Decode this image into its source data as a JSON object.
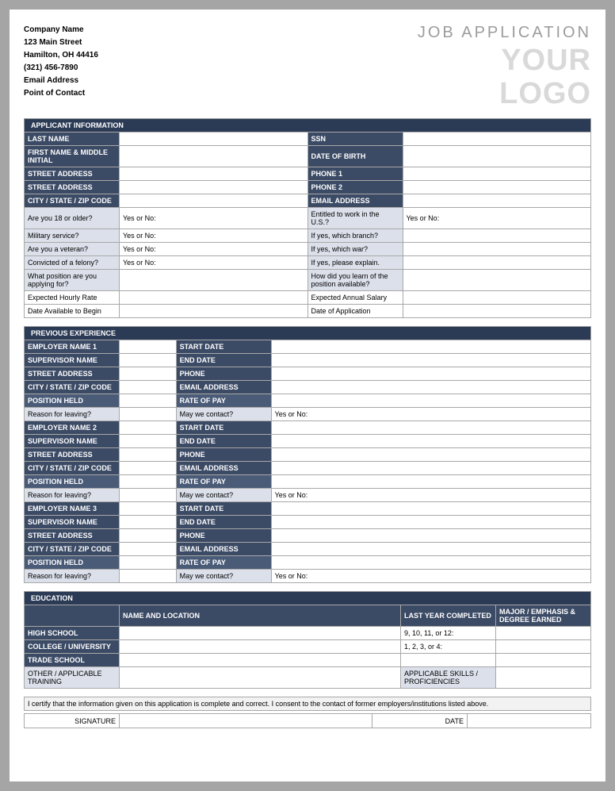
{
  "company": {
    "name": "Company Name",
    "street": "123 Main Street",
    "citystate": "Hamilton, OH 44416",
    "phone": "(321) 456-7890",
    "email": "Email Address",
    "contact": "Point of Contact"
  },
  "header": {
    "title": "JOB APPLICATION",
    "logo1": "YOUR",
    "logo2": "LOGO"
  },
  "sec": {
    "applicant": "APPLICANT INFORMATION",
    "previous": "PREVIOUS EXPERIENCE",
    "education": "EDUCATION"
  },
  "app": {
    "last_name": "LAST NAME",
    "ssn": "SSN",
    "first_mi": "FIRST NAME & MIDDLE INITIAL",
    "dob": "DATE OF BIRTH",
    "street1": "STREET ADDRESS",
    "phone1": "PHONE 1",
    "street2": "STREET ADDRESS",
    "phone2": "PHONE 2",
    "csz": "CITY / STATE / ZIP CODE",
    "email": "EMAIL ADDRESS",
    "age18": "Are you 18 or older?",
    "yesno": "Yes or No:",
    "entitled": "Entitled to work in the U.S.?",
    "military": "Military service?",
    "branch": "If yes, which branch?",
    "veteran": "Are you a veteran?",
    "war": "If yes, which war?",
    "felony": "Convicted of a felony?",
    "explain": "If yes, please explain.",
    "position": "What position are you applying for?",
    "learn": "How did you learn of the position available?",
    "hourly": "Expected Hourly Rate",
    "salary": "Expected Annual Salary",
    "date_begin": "Date Available to Begin",
    "date_app": "Date of Application"
  },
  "exp": {
    "emp1": "EMPLOYER NAME 1",
    "emp2": "EMPLOYER NAME 2",
    "emp3": "EMPLOYER NAME 3",
    "start": "START DATE",
    "end": "END DATE",
    "sup": "SUPERVISOR NAME",
    "street": "STREET ADDRESS",
    "phone": "PHONE",
    "csz": "CITY / STATE / ZIP CODE",
    "email": "EMAIL ADDRESS",
    "pos": "POSITION HELD",
    "rate": "RATE OF PAY",
    "reason": "Reason for leaving?",
    "contact": "May we contact?",
    "yesno": "Yes or No:"
  },
  "edu": {
    "name_loc": "NAME AND LOCATION",
    "last_year": "LAST YEAR COMPLETED",
    "major": "MAJOR / EMPHASIS & DEGREE EARNED",
    "hs": "HIGH SCHOOL",
    "hs_hint": "9, 10, 11, or 12:",
    "college": "COLLEGE / UNIVERSITY",
    "college_hint": "1, 2, 3, or 4:",
    "trade": "TRADE SCHOOL",
    "other": "OTHER / APPLICABLE TRAINING",
    "skills": "APPLICABLE SKILLS / PROFICIENCIES"
  },
  "certify": "I certify that the information given on this application is complete and correct. I consent to the contact of former employers/institutions listed above.",
  "sig": {
    "signature": "SIGNATURE",
    "date": "DATE"
  }
}
